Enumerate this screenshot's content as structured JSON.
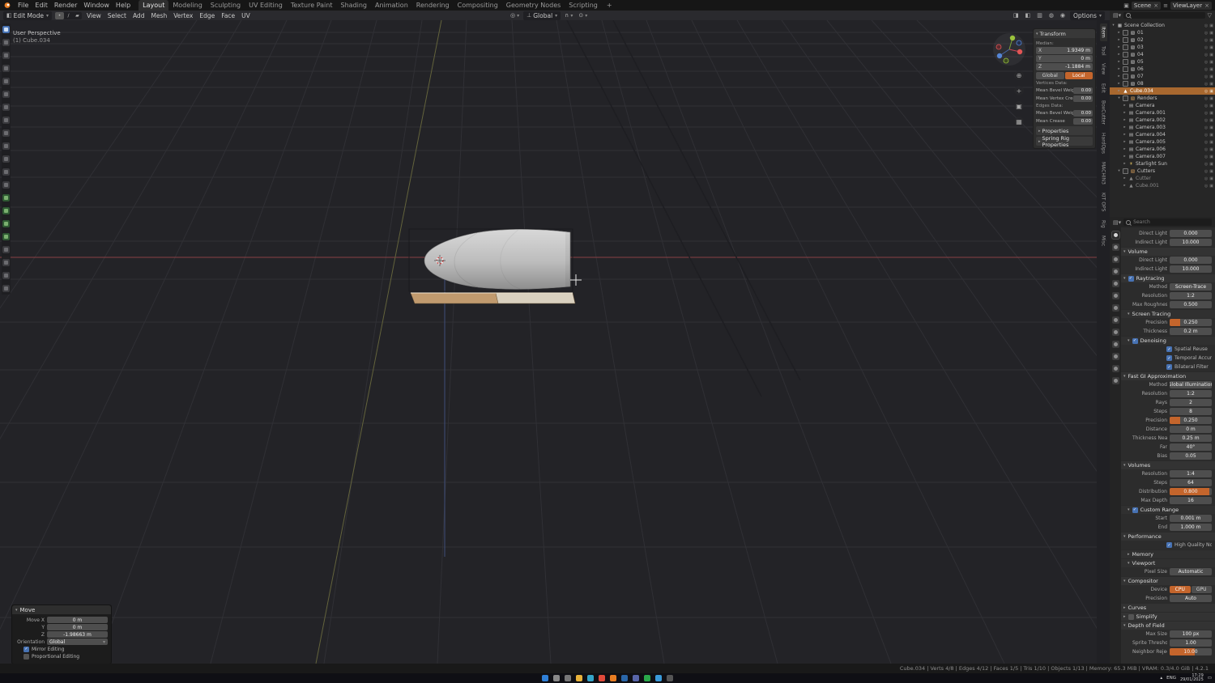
{
  "colors": {
    "accent": "#c4652c",
    "select_blue": "#4772b3",
    "object_selected_row": "#a8682f"
  },
  "topbar": {
    "menus": [
      "File",
      "Edit",
      "Render",
      "Window",
      "Help"
    ],
    "workspaces": [
      {
        "label": "Layout",
        "active": true
      },
      {
        "label": "Modeling"
      },
      {
        "label": "Sculpting"
      },
      {
        "label": "UV Editing"
      },
      {
        "label": "Texture Paint"
      },
      {
        "label": "Shading"
      },
      {
        "label": "Animation"
      },
      {
        "label": "Rendering"
      },
      {
        "label": "Compositing"
      },
      {
        "label": "Geometry Nodes"
      },
      {
        "label": "Scripting"
      }
    ],
    "add_workspace": "+",
    "scene": "Scene",
    "viewlayer": "ViewLayer"
  },
  "viewport_header": {
    "mode": "Edit Mode",
    "menus": [
      "View",
      "Select",
      "Add",
      "Mesh",
      "Vertex",
      "Edge",
      "Face",
      "UV"
    ],
    "orientation": "Global",
    "options": "Options"
  },
  "viewport": {
    "overlay": [
      "User Perspective",
      "(1) Cube.034"
    ],
    "nav_icons": [
      {
        "name": "zoom",
        "glyph": "⊕"
      },
      {
        "name": "pan",
        "glyph": "+"
      },
      {
        "name": "camera-view",
        "glyph": "▣"
      },
      {
        "name": "toggle-perspective",
        "glyph": "▦"
      }
    ]
  },
  "toolbar": {
    "tools": [
      {
        "name": "tweak",
        "active": true
      },
      {
        "name": "select-box"
      },
      {
        "name": "cursor"
      },
      {
        "name": "move"
      },
      {
        "name": "rotate"
      },
      {
        "name": "scale"
      },
      {
        "name": "transform"
      },
      {
        "name": "annotate"
      },
      {
        "name": "measure"
      },
      {
        "name": "add-cube"
      },
      {
        "name": "extrude-region"
      },
      {
        "name": "inset-faces"
      },
      {
        "name": "bevel"
      },
      {
        "name": "loop-cut",
        "green": true
      },
      {
        "name": "knife",
        "green": true
      },
      {
        "name": "poly-build",
        "green": true
      },
      {
        "name": "spin",
        "green": true
      },
      {
        "name": "smooth"
      },
      {
        "name": "edge-slide"
      },
      {
        "name": "shrink-flatten"
      },
      {
        "name": "rip-region"
      }
    ]
  },
  "npanel": {
    "tabs": [
      "Item",
      "Tool",
      "View",
      "Edit",
      "BoxCutter",
      "HardOps",
      "MACHIN3",
      "KIT OPS",
      "Rig",
      "Misc"
    ],
    "transform_title": "Transform",
    "median_label": "Median:",
    "axes": [
      {
        "axis": "X",
        "value": "1.9349 m"
      },
      {
        "axis": "Y",
        "value": "0 m"
      },
      {
        "axis": "Z",
        "value": "-1.1884 m"
      }
    ],
    "space_global": "Global",
    "space_local": "Local",
    "vertices_label": "Vertices Data:",
    "vertex_rows": [
      {
        "label": "Mean Bevel Weight",
        "value": "0.00"
      },
      {
        "label": "Mean Vertex Crease",
        "value": "0.00"
      }
    ],
    "edges_label": "Edges Data:",
    "edge_rows": [
      {
        "label": "Mean Bevel Weight",
        "value": "0.00"
      },
      {
        "label": "Mean Crease",
        "value": "0.00"
      }
    ],
    "collapsed_panels": [
      "Properties",
      "Spring Rig Properties"
    ]
  },
  "outliner": {
    "items": [
      {
        "ind": 0,
        "disc": "▾",
        "icon": "▦",
        "ic": "#cfcfcf",
        "label": "Scene Collection"
      },
      {
        "ind": 1,
        "disc": "▸",
        "pre": true,
        "icon": "▧",
        "ic": "#cfcfcf",
        "label": "01"
      },
      {
        "ind": 1,
        "disc": "▸",
        "pre": true,
        "icon": "▧",
        "ic": "#cfcfcf",
        "label": "02"
      },
      {
        "ind": 1,
        "disc": "▸",
        "pre": true,
        "icon": "▧",
        "ic": "#cfcfcf",
        "label": "03"
      },
      {
        "ind": 1,
        "disc": "▸",
        "pre": true,
        "icon": "▧",
        "ic": "#cfcfcf",
        "label": "04"
      },
      {
        "ind": 1,
        "disc": "▸",
        "pre": true,
        "icon": "▧",
        "ic": "#cfcfcf",
        "label": "05"
      },
      {
        "ind": 1,
        "disc": "▸",
        "pre": true,
        "icon": "▧",
        "ic": "#cfcfcf",
        "label": "06"
      },
      {
        "ind": 1,
        "disc": "▸",
        "pre": true,
        "icon": "▧",
        "ic": "#cfcfcf",
        "label": "07"
      },
      {
        "ind": 1,
        "disc": "▸",
        "pre": true,
        "icon": "▧",
        "ic": "#cfcfcf",
        "label": "08"
      },
      {
        "ind": 1,
        "disc": "▸",
        "icon": "▲",
        "ic": "#ffffff",
        "label": "Cube.034",
        "sel": true
      },
      {
        "ind": 1,
        "disc": "▾",
        "pre": true,
        "icon": "▧",
        "ic": "#d9a05c",
        "label": "Renders"
      },
      {
        "ind": 2,
        "disc": "▸",
        "icon": "▤",
        "ic": "#bdbdbd",
        "label": "Camera"
      },
      {
        "ind": 2,
        "disc": "▸",
        "icon": "▤",
        "ic": "#bdbdbd",
        "label": "Camera.001"
      },
      {
        "ind": 2,
        "disc": "▸",
        "icon": "▤",
        "ic": "#bdbdbd",
        "label": "Camera.002"
      },
      {
        "ind": 2,
        "disc": "▸",
        "icon": "▤",
        "ic": "#bdbdbd",
        "label": "Camera.003"
      },
      {
        "ind": 2,
        "disc": "▸",
        "icon": "▤",
        "ic": "#bdbdbd",
        "label": "Camera.004"
      },
      {
        "ind": 2,
        "disc": "▸",
        "icon": "▤",
        "ic": "#bdbdbd",
        "label": "Camera.005"
      },
      {
        "ind": 2,
        "disc": "▸",
        "icon": "▤",
        "ic": "#bdbdbd",
        "label": "Camera.006"
      },
      {
        "ind": 2,
        "disc": "▸",
        "icon": "▤",
        "ic": "#bdbdbd",
        "label": "Camera.007"
      },
      {
        "ind": 2,
        "disc": "▸",
        "icon": "☀",
        "ic": "#e6c462",
        "label": "Starlight Sun"
      },
      {
        "ind": 1,
        "disc": "▾",
        "pre": true,
        "icon": "▧",
        "ic": "#d9a05c",
        "label": "Cutters"
      },
      {
        "ind": 2,
        "disc": "▸",
        "icon": "▲",
        "ic": "#8a8a8a",
        "label": "Cutter",
        "mut": true
      },
      {
        "ind": 2,
        "disc": "▸",
        "icon": "▲",
        "ic": "#8a8a8a",
        "label": "Cube.001",
        "mut": true
      }
    ]
  },
  "properties": {
    "search_placeholder": "Search",
    "tabs": [
      {
        "name": "render",
        "active": true
      },
      {
        "name": "output"
      },
      {
        "name": "view-layer"
      },
      {
        "name": "scene"
      },
      {
        "name": "world"
      },
      {
        "name": "object"
      },
      {
        "name": "modifiers"
      },
      {
        "name": "particles"
      },
      {
        "name": "physics"
      },
      {
        "name": "constraints"
      },
      {
        "name": "object-data"
      },
      {
        "name": "material"
      },
      {
        "name": "texture"
      }
    ],
    "rows": [
      {
        "t": "kv",
        "label": "Direct Light",
        "value": "0.000",
        "ind": 1
      },
      {
        "t": "kv",
        "label": "Indirect Light",
        "value": "10.000",
        "ind": 1
      },
      {
        "t": "sec",
        "label": "Volume",
        "open": true
      },
      {
        "t": "kv",
        "label": "Direct Light",
        "value": "0.000",
        "ind": 1
      },
      {
        "t": "kv",
        "label": "Indirect Light",
        "value": "10.000",
        "ind": 1
      },
      {
        "t": "sec",
        "label": "Raytracing",
        "open": true,
        "chk": true
      },
      {
        "t": "kv",
        "label": "Method",
        "value": "Screen-Trace",
        "ind": 1
      },
      {
        "t": "kv",
        "label": "Resolution",
        "value": "1:2",
        "ind": 1
      },
      {
        "t": "kv",
        "label": "Max Roughness",
        "value": "0.500",
        "ind": 1
      },
      {
        "t": "sec",
        "label": "Screen Tracing",
        "open": true,
        "sub": true
      },
      {
        "t": "kv",
        "label": "Precision",
        "value": "0.250",
        "fill": 25,
        "ind": 1
      },
      {
        "t": "kv",
        "label": "Thickness",
        "value": "0.2 m",
        "ind": 1
      },
      {
        "t": "sec",
        "label": "Denoising",
        "open": true,
        "chk": true,
        "sub": true
      },
      {
        "t": "chk",
        "label": "Spatial Reuse",
        "on": true,
        "ind": 1
      },
      {
        "t": "chk",
        "label": "Temporal Accumulation",
        "on": true,
        "ind": 1
      },
      {
        "t": "chk",
        "label": "Bilateral Filter",
        "on": true,
        "ind": 1
      },
      {
        "t": "sec",
        "label": "Fast GI Approximation",
        "open": true
      },
      {
        "t": "kv",
        "label": "Method",
        "value": "Global Illumination",
        "ind": 1
      },
      {
        "t": "kv",
        "label": "Resolution",
        "value": "1:2",
        "ind": 1
      },
      {
        "t": "kv",
        "label": "Rays",
        "value": "2",
        "ind": 1
      },
      {
        "t": "kv",
        "label": "Steps",
        "value": "8",
        "ind": 1
      },
      {
        "t": "kv",
        "label": "Precision",
        "value": "0.250",
        "fill": 25,
        "ind": 1
      },
      {
        "t": "kv",
        "label": "Distance",
        "value": "0 m",
        "ind": 1
      },
      {
        "t": "kv",
        "label": "Thickness Near",
        "value": "0.25 m",
        "ind": 1
      },
      {
        "t": "kv",
        "label": "Far",
        "value": "40°",
        "ind": 2
      },
      {
        "t": "kv",
        "label": "Bias",
        "value": "0.05",
        "ind": 1
      },
      {
        "t": "sec",
        "label": "Volumes",
        "open": true
      },
      {
        "t": "kv",
        "label": "Resolution",
        "value": "1:4",
        "ind": 1
      },
      {
        "t": "kv",
        "label": "Steps",
        "value": "64",
        "ind": 1
      },
      {
        "t": "kv",
        "label": "Distribution",
        "value": "0.800",
        "fill": 95,
        "ind": 1
      },
      {
        "t": "kv",
        "label": "Max Depth",
        "value": "16",
        "ind": 1
      },
      {
        "t": "sec",
        "label": "Custom Range",
        "open": true,
        "chk": true,
        "sub": true
      },
      {
        "t": "kv",
        "label": "Start",
        "value": "0.001 m",
        "ind": 1
      },
      {
        "t": "kv",
        "label": "End",
        "value": "1.000 m",
        "ind": 1
      },
      {
        "t": "sec",
        "label": "Performance",
        "open": true
      },
      {
        "t": "chk",
        "label": "High Quality Normals",
        "on": true,
        "ind": 1
      },
      {
        "t": "sec",
        "label": "Memory",
        "open": false,
        "sub": true
      },
      {
        "t": "sec",
        "label": "Viewport",
        "open": true,
        "sub": true
      },
      {
        "t": "kv",
        "label": "Pixel Size",
        "value": "Automatic",
        "ind": 1
      },
      {
        "t": "sec",
        "label": "Compositor",
        "open": true
      },
      {
        "t": "btns",
        "label": "Device",
        "options": [
          "CPU",
          "GPU"
        ],
        "active": 0,
        "ind": 1
      },
      {
        "t": "kv",
        "label": "Precision",
        "value": "Auto",
        "ind": 1
      },
      {
        "t": "sec",
        "label": "Curves",
        "open": false
      },
      {
        "t": "sec",
        "label": "Simplify",
        "open": false,
        "chk": false
      },
      {
        "t": "sec",
        "label": "Depth of Field",
        "open": true
      },
      {
        "t": "kv",
        "label": "Max Size",
        "value": "100 px",
        "ind": 1
      },
      {
        "t": "kv",
        "label": "Sprite Threshold",
        "value": "1.00",
        "ind": 1
      },
      {
        "t": "kv",
        "label": "Neighbor Rejection",
        "value": "10.00",
        "fill": 60,
        "ind": 1
      }
    ]
  },
  "operator_panel": {
    "title": "Move",
    "fields": [
      {
        "label": "Move X",
        "value": "0 m"
      },
      {
        "label": "Y",
        "value": "0 m"
      },
      {
        "label": "Z",
        "value": "-1.98663 m"
      }
    ],
    "orientation_label": "Orientation",
    "orientation_value": "Global",
    "checkboxes": [
      {
        "label": "Mirror Editing",
        "on": true
      },
      {
        "label": "Proportional Editing",
        "on": false
      }
    ]
  },
  "statusbar": {
    "right": "Cube.034 | Verts 4/8 | Edges 4/12 | Faces 1/5 | Tris 1/10 | Objects 1/13 | Memory: 65.3 MiB | VRAM: 0.3/4.0 GiB | 4.2.1"
  },
  "taskbar": {
    "tray_lang": "ENG",
    "tray_time": "17:29",
    "tray_date": "29/01/2025",
    "icons": [
      {
        "name": "start",
        "color": "#2f7fd6"
      },
      {
        "name": "search",
        "color": "#888888"
      },
      {
        "name": "task-view",
        "color": "#777777"
      },
      {
        "name": "file-explorer",
        "color": "#e8b23a"
      },
      {
        "name": "edge",
        "color": "#35a4c8"
      },
      {
        "name": "chrome",
        "color": "#e04a3a"
      },
      {
        "name": "blender",
        "color": "#e87d22"
      },
      {
        "name": "photoshop",
        "color": "#2a66a8"
      },
      {
        "name": "discord",
        "color": "#5865a8"
      },
      {
        "name": "spotify",
        "color": "#2aa84a"
      },
      {
        "name": "vscode",
        "color": "#3a9ad9"
      },
      {
        "name": "terminal",
        "color": "#555555"
      }
    ]
  }
}
